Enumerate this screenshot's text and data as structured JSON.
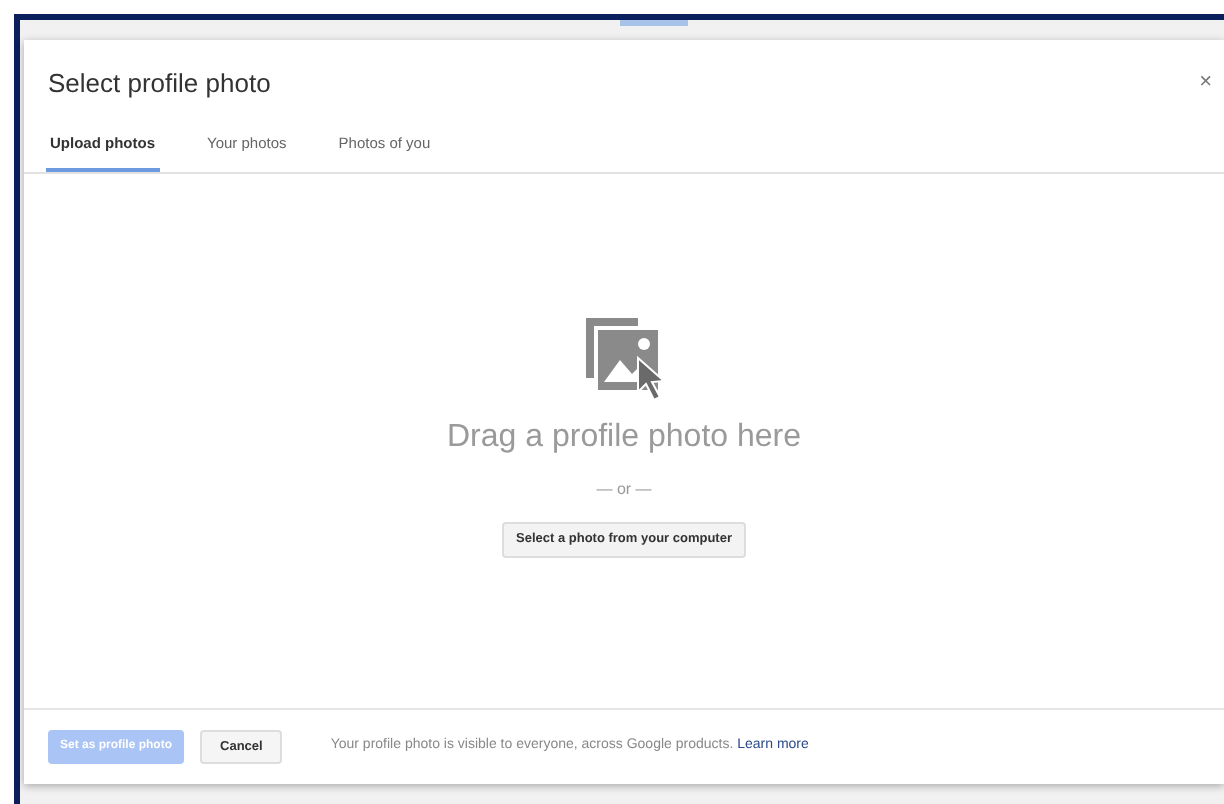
{
  "dialog": {
    "title": "Select profile photo",
    "close": "×"
  },
  "tabs": [
    {
      "label": "Upload photos",
      "selected": true
    },
    {
      "label": "Your photos",
      "selected": false
    },
    {
      "label": "Photos of you",
      "selected": false
    }
  ],
  "upload": {
    "heading": "Drag a profile photo here",
    "separator": "— or —",
    "button": "Select a photo from your computer"
  },
  "footer": {
    "primary": {
      "label": "Set as profile photo",
      "disabled": true
    },
    "cancel": "Cancel",
    "note": "Your profile photo is visible to everyone, across Google products.",
    "link": "Learn more"
  }
}
